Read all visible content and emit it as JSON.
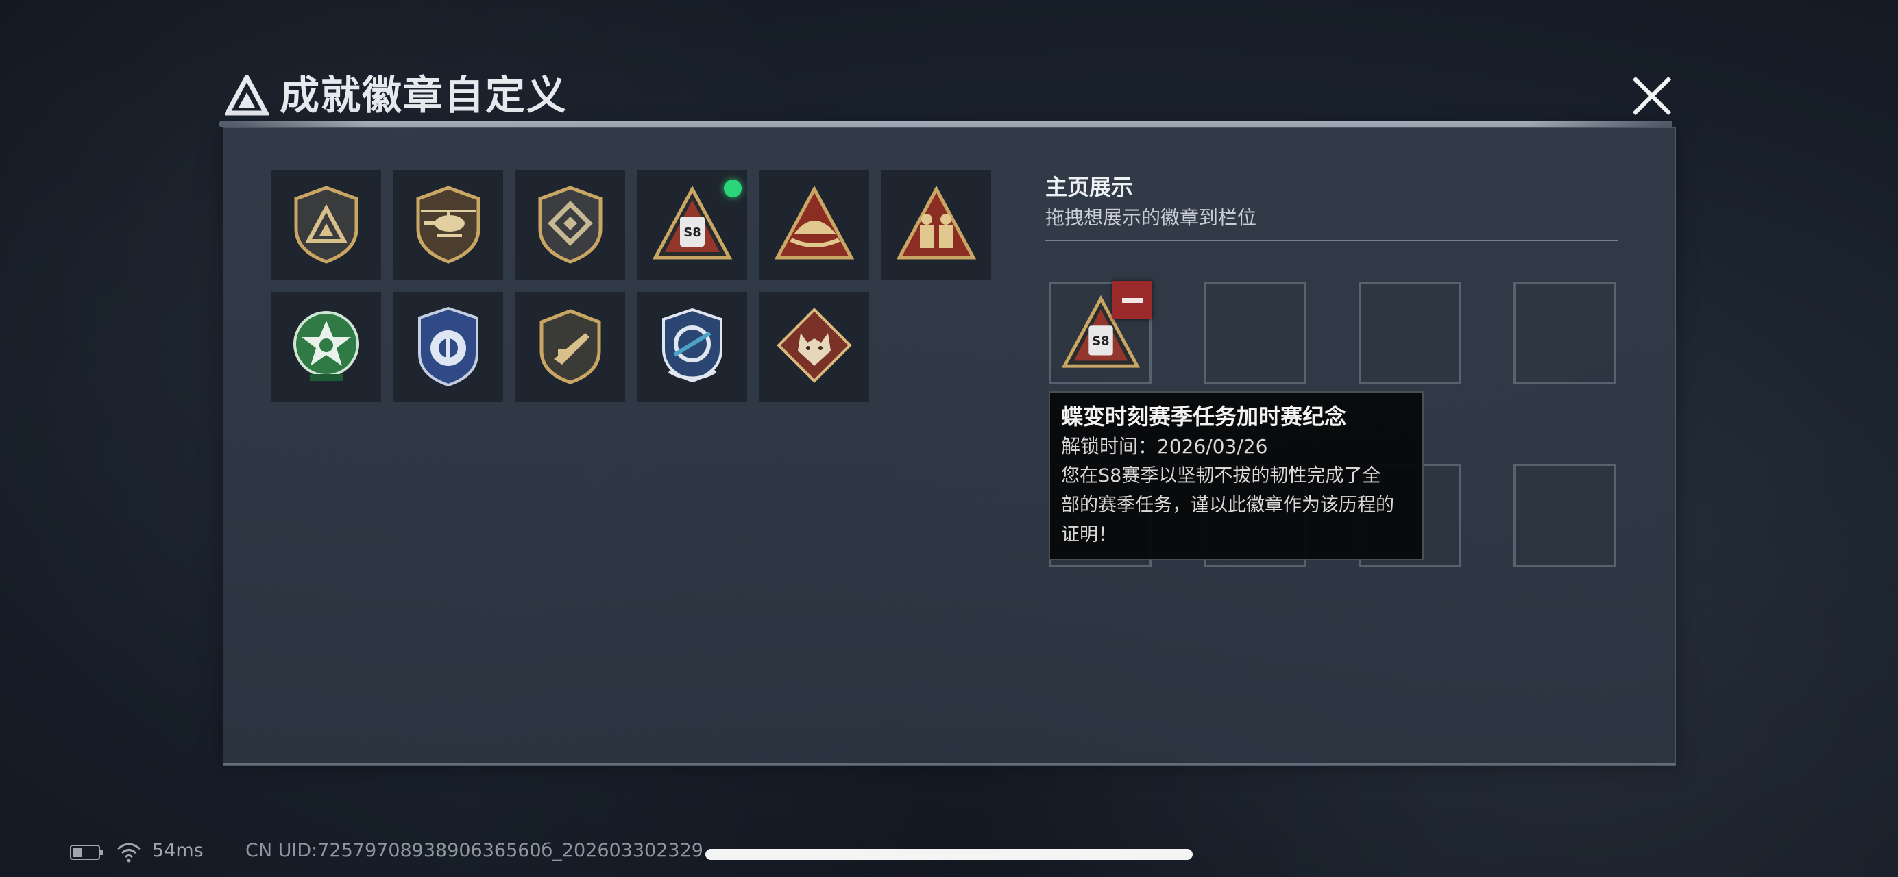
{
  "header": {
    "title": "成就徽章自定义"
  },
  "badges": [
    {
      "name": "delta-shield-badge"
    },
    {
      "name": "helicopter-badge"
    },
    {
      "name": "diamond-shield-badge"
    },
    {
      "name": "s8-season-badge",
      "new": true
    },
    {
      "name": "sailboat-triangle-badge"
    },
    {
      "name": "soldiers-triangle-badge"
    },
    {
      "name": "green-star-badge"
    },
    {
      "name": "blue-police-badge"
    },
    {
      "name": "rifle-badge"
    },
    {
      "name": "blue-target-badge"
    },
    {
      "name": "wolf-badge"
    }
  ],
  "showcase": {
    "title": "主页展示",
    "subtitle": "拖拽想展示的徽章到栏位"
  },
  "tooltip": {
    "title": "蝶变时刻赛季任务加时赛纪念",
    "unlock_time": "解锁时间：2026/03/26",
    "description_line1": "您在S8赛季以坚韧不拔的韧性完成了全",
    "description_line2": "部的赛季任务，谨以此徽章作为该历程的",
    "description_line3": "证明！"
  },
  "badge_season_text": "S8",
  "status": {
    "ping": "54ms",
    "uid": "CN UID:7257970893890636560б_202603302329"
  },
  "colors": {
    "accent_gold": "#c9a664",
    "new_dot": "#2bd67b",
    "remove": "#9b2a2a"
  }
}
